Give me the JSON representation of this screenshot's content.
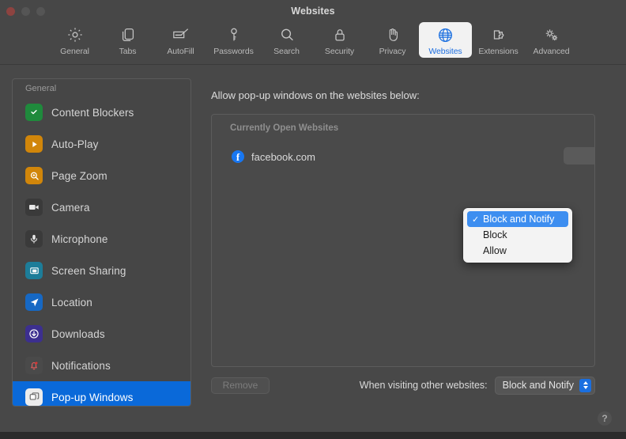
{
  "window": {
    "title": "Websites",
    "traffic_lights": [
      "close-button",
      "minimize-button",
      "zoom-button"
    ]
  },
  "toolbar": {
    "items": [
      {
        "label": "General",
        "icon": "gear-icon",
        "active": false
      },
      {
        "label": "Tabs",
        "icon": "tabs-icon",
        "active": false
      },
      {
        "label": "AutoFill",
        "icon": "autofill-icon",
        "active": false
      },
      {
        "label": "Passwords",
        "icon": "key-icon",
        "active": false
      },
      {
        "label": "Search",
        "icon": "magnifier-icon",
        "active": false
      },
      {
        "label": "Security",
        "icon": "lock-icon",
        "active": false
      },
      {
        "label": "Privacy",
        "icon": "hand-icon",
        "active": false
      },
      {
        "label": "Websites",
        "icon": "globe-icon",
        "active": true
      },
      {
        "label": "Extensions",
        "icon": "puzzle-icon",
        "active": false
      },
      {
        "label": "Advanced",
        "icon": "gears-icon",
        "active": false
      }
    ]
  },
  "sidebar": {
    "header": "General",
    "items": [
      {
        "label": "Content Blockers",
        "icon": "shield-check-icon",
        "selected": false
      },
      {
        "label": "Auto-Play",
        "icon": "play-icon",
        "selected": false
      },
      {
        "label": "Page Zoom",
        "icon": "zoom-in-icon",
        "selected": false
      },
      {
        "label": "Camera",
        "icon": "camera-icon",
        "selected": false
      },
      {
        "label": "Microphone",
        "icon": "microphone-icon",
        "selected": false
      },
      {
        "label": "Screen Sharing",
        "icon": "screen-share-icon",
        "selected": false
      },
      {
        "label": "Location",
        "icon": "location-arrow-icon",
        "selected": false
      },
      {
        "label": "Downloads",
        "icon": "download-icon",
        "selected": false
      },
      {
        "label": "Notifications",
        "icon": "bell-icon",
        "selected": false
      },
      {
        "label": "Pop-up Windows",
        "icon": "windows-icon",
        "selected": true
      }
    ]
  },
  "main": {
    "heading": "Allow pop-up windows on the websites below:",
    "list_group_header": "Currently Open Websites",
    "sites": [
      {
        "name": "facebook.com",
        "favicon": "facebook-icon",
        "setting": "Block and Notify"
      }
    ],
    "remove_label": "Remove",
    "footer_label": "When visiting other websites:",
    "default_setting": "Block and Notify",
    "help_label": "?"
  },
  "popup_menu": {
    "open": true,
    "options": [
      {
        "label": "Block and Notify",
        "checked": true
      },
      {
        "label": "Block",
        "checked": false
      },
      {
        "label": "Allow",
        "checked": false
      }
    ],
    "check_glyph": "✓"
  },
  "colors": {
    "window_bg": "#484848",
    "toolbar_bg": "#474747",
    "accent_blue": "#0a69d9",
    "menu_highlight": "#3d8ef0",
    "active_tab_text": "#1d6ee0",
    "facebook_blue": "#1877f2"
  }
}
